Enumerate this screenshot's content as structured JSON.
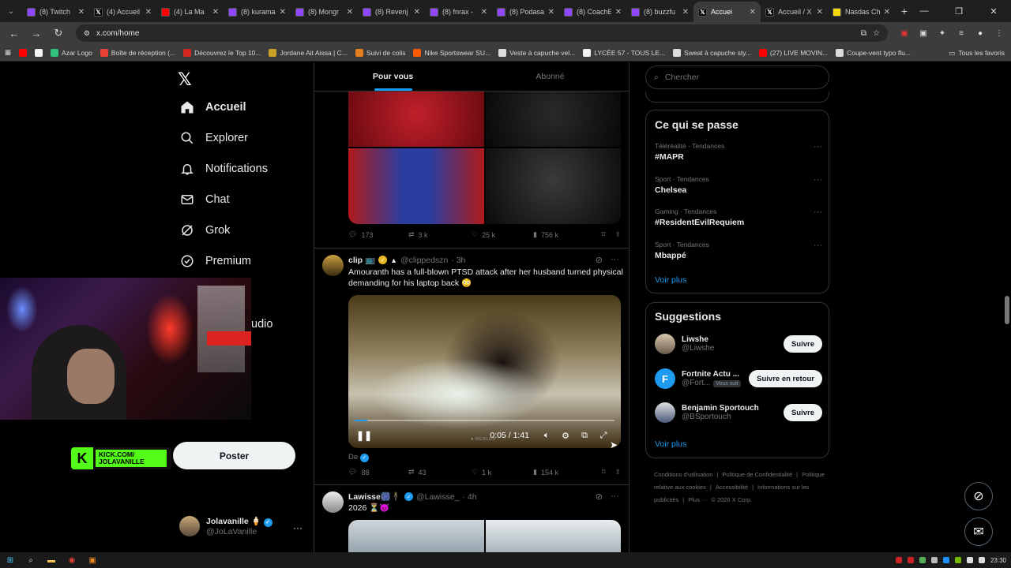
{
  "tabs": [
    {
      "title": "(8) Twitch",
      "icon": "twitch-icon",
      "color": "#9146ff"
    },
    {
      "title": "(4) Accueil",
      "icon": "x-icon",
      "color": "#000000"
    },
    {
      "title": "(4) La Ma",
      "icon": "youtube-icon",
      "color": "#ff0000"
    },
    {
      "title": "(8) kurama",
      "icon": "twitch-icon",
      "color": "#9146ff"
    },
    {
      "title": "(8) Mongr",
      "icon": "twitch-icon",
      "color": "#9146ff"
    },
    {
      "title": "(8) Revenj",
      "icon": "twitch-icon",
      "color": "#9146ff"
    },
    {
      "title": "(8) fnrax -",
      "icon": "twitch-icon",
      "color": "#9146ff"
    },
    {
      "title": "(8) Podasa",
      "icon": "twitch-icon",
      "color": "#9146ff"
    },
    {
      "title": "(8) CoachE",
      "icon": "twitch-icon",
      "color": "#9146ff"
    },
    {
      "title": "(8) buzzfu",
      "icon": "twitch-icon",
      "color": "#9146ff"
    },
    {
      "title": "Accuei",
      "icon": "x-icon",
      "color": "#000000",
      "active": true
    },
    {
      "title": "Accueil / X",
      "icon": "x-icon",
      "color": "#000000"
    },
    {
      "title": "Nasdas Ch",
      "icon": "nasdas-icon",
      "color": "#f5d90a"
    }
  ],
  "toolbar": {
    "url": "x.com/home"
  },
  "bookmarks": [
    {
      "label": "",
      "color": "#ff0000"
    },
    {
      "label": "",
      "color": "#f5f5f5"
    },
    {
      "label": "Azar Logo",
      "color": "#2ec27e"
    },
    {
      "label": "Boîte de réception (...",
      "color": "#ea4335"
    },
    {
      "label": "Découvrez le Top 10...",
      "color": "#d6261f"
    },
    {
      "label": "Jordane Ait Aissa | C...",
      "color": "#c9a227"
    },
    {
      "label": "Suivi de colis",
      "color": "#e67e22"
    },
    {
      "label": "Nike Sportswear SU...",
      "color": "#ff5a00"
    },
    {
      "label": "Veste à capuche vel...",
      "color": "#dddddd"
    },
    {
      "label": "LYCÉE 57 - TOUS LE...",
      "color": "#f1f1f1"
    },
    {
      "label": "Sweat à capuche sty...",
      "color": "#dddddd"
    },
    {
      "label": "(27) LIVE MOVIN...",
      "color": "#ff0000"
    },
    {
      "label": "Coupe-vent typo flu...",
      "color": "#dddddd"
    }
  ],
  "bookmarks_all": "Tous les favoris",
  "nav": {
    "items": [
      {
        "label": "Accueil",
        "icon": "home-icon"
      },
      {
        "label": "Explorer",
        "icon": "search-icon"
      },
      {
        "label": "Notifications",
        "icon": "bell-icon"
      },
      {
        "label": "Chat",
        "icon": "mail-icon"
      },
      {
        "label": "Grok",
        "icon": "grok-icon"
      },
      {
        "label": "Premium",
        "icon": "premium-icon"
      }
    ],
    "studio_fragment": "udio",
    "post_label": "Poster"
  },
  "kick_overlay": {
    "line1": "KICK.COM/",
    "line2": "JOLAVANILLE"
  },
  "account": {
    "name": "Jolavanille 🍦",
    "handle": "@JoLaVanille"
  },
  "feed": {
    "tabs": [
      "Pour vous",
      "Abonné"
    ],
    "post1_stats": {
      "replies": "173",
      "reposts": "3 k",
      "likes": "25 k",
      "views": "756 k"
    },
    "post2": {
      "name": "clip 📺",
      "handle": "@clippedszn",
      "time": "· 3h",
      "text": "Amouranth has a full-blown PTSD attack after her husband turned physical demanding for his laptop back 😳",
      "video_time": "0:05 / 1:41",
      "video_progress": 0.05,
      "translation": "De",
      "stats": {
        "replies": "88",
        "reposts": "43",
        "likes": "1 k",
        "views": "154 k"
      }
    },
    "post3": {
      "name": "Lawisse🎆🕴",
      "handle": "@Lawisse_",
      "time": "· 4h",
      "text": "2026 ⏳😈"
    }
  },
  "right": {
    "search_placeholder": "Chercher",
    "trends_title": "Ce qui se passe",
    "trends": [
      {
        "category": "Téléréalité · Tendances",
        "title": "#MAPR"
      },
      {
        "category": "Sport · Tendances",
        "title": "Chelsea"
      },
      {
        "category": "Gaming · Tendances",
        "title": "#ResidentEvilRequiem"
      },
      {
        "category": "Sport · Tendances",
        "title": "Mbappé"
      }
    ],
    "trends_more": "Voir plus",
    "sugg_title": "Suggestions",
    "suggestions": [
      {
        "name": "Liwshe",
        "handle": "@Liwshe",
        "button": "Suivre",
        "badge": ""
      },
      {
        "name": "Fortnite Actu ...",
        "handle": "@Fort...",
        "button": "Suivre en retour",
        "badge": "Vous suit"
      },
      {
        "name": "Benjamin Sportouch",
        "handle": "@BSportouch",
        "button": "Suivre",
        "badge": ""
      }
    ],
    "sugg_more": "Voir plus",
    "footer": [
      "Conditions d'utilisation",
      "|",
      "Politique de Confidentialité",
      "|",
      "Politique relative aux cookies",
      "|",
      "Accessibilité",
      "|",
      "Informations sur les publicités",
      "|",
      "Plus ···",
      "© 2026 X Corp."
    ]
  },
  "taskbar": {
    "clock": "23:30"
  }
}
